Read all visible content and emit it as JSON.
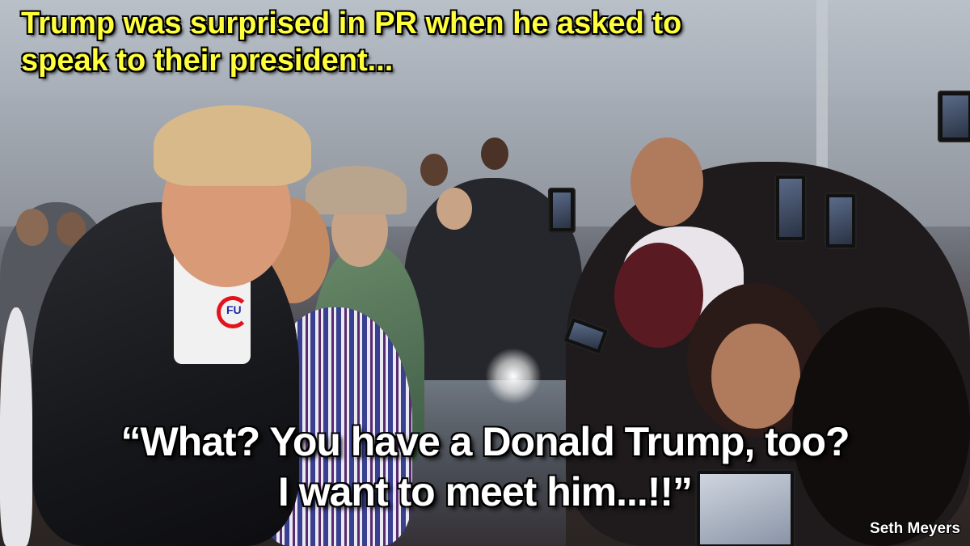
{
  "headline": {
    "line1": "Trump was surprised in PR when he asked to",
    "line2": "speak to their president..."
  },
  "quote": {
    "line1": "“What? You have a Donald Trump, too?",
    "line2": "I want to meet him...!!”"
  },
  "badge": {
    "text": "FU"
  },
  "credit": {
    "text": "Seth Meyers"
  },
  "colors": {
    "headline": "#ffff3c",
    "quote": "#ffffff",
    "badge_ring": "#e3121b",
    "badge_text": "#1b2a9c"
  }
}
